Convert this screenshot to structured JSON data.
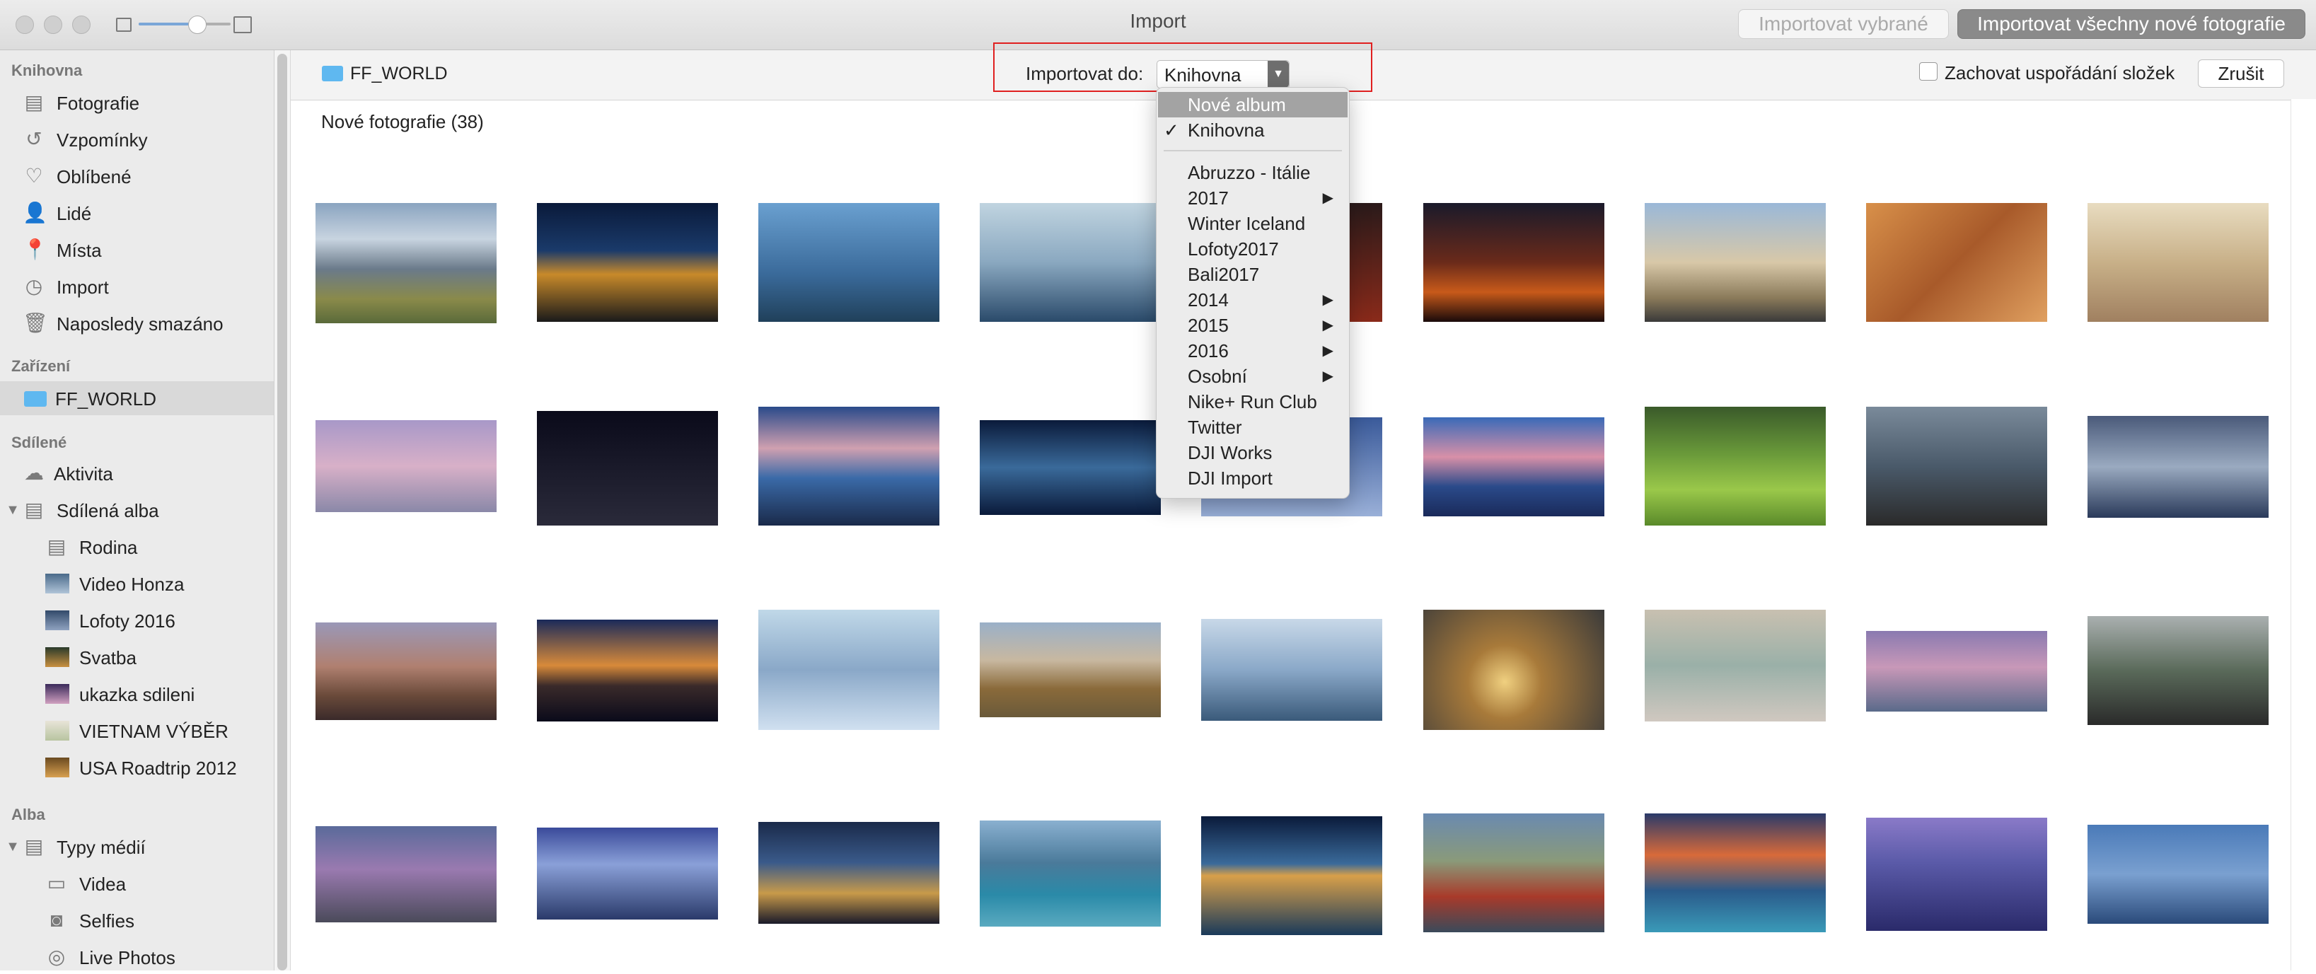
{
  "window": {
    "title": "Import",
    "btn_import_selected": "Importovat vybrané",
    "btn_import_all": "Importovat všechny nové fotografie"
  },
  "sidebar": {
    "library_header": "Knihovna",
    "library": [
      "Fotografie",
      "Vzpomínky",
      "Oblíbené",
      "Lidé",
      "Místa",
      "Import",
      "Naposledy smazáno"
    ],
    "devices_header": "Zařízení",
    "device": "FF_WORLD",
    "shared_header": "Sdílené",
    "activity": "Aktivita",
    "shared_albums": "Sdílená alba",
    "shared": [
      "Rodina",
      "Video Honza",
      "Lofoty 2016",
      "Svatba",
      "ukazka sdileni",
      "VIETNAM VÝBĚR",
      "USA Roadtrip 2012"
    ],
    "albums_header": "Alba",
    "media_types": "Typy médií",
    "media": [
      "Videa",
      "Selfies",
      "Live Photos"
    ]
  },
  "header": {
    "folder": "FF_WORLD",
    "import_to_label": "Importovat do:",
    "import_to_value": "Knihovna",
    "keep_folders": "Zachovat uspořádání složek",
    "keep_folders_checked": false,
    "cancel": "Zrušit"
  },
  "section_title": "Nové fotografie (38)",
  "menu": {
    "items": [
      {
        "label": "Nové album",
        "highlighted": true
      },
      {
        "label": "Knihovna",
        "checked": true
      },
      {
        "label": "Abruzzo - Itálie"
      },
      {
        "label": "2017",
        "submenu": true
      },
      {
        "label": "Winter Iceland"
      },
      {
        "label": "Lofoty2017"
      },
      {
        "label": "Bali2017"
      },
      {
        "label": "2014",
        "submenu": true
      },
      {
        "label": "2015",
        "submenu": true
      },
      {
        "label": "2016",
        "submenu": true
      },
      {
        "label": "Osobní",
        "submenu": true
      },
      {
        "label": "Nike+ Run Club"
      },
      {
        "label": "Twitter"
      },
      {
        "label": "DJI Works"
      },
      {
        "label": "DJI Import"
      }
    ]
  },
  "colors": {
    "selection_highlight": "#a3a3a3",
    "annotation_red": "#e02020",
    "folder_blue": "#5fb8f0"
  }
}
